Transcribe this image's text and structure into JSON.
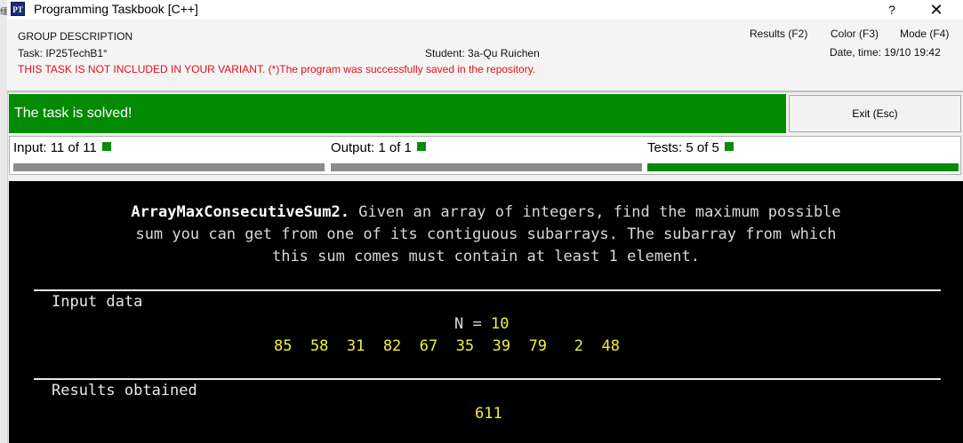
{
  "window": {
    "edge_glyph": "缅",
    "icon_text": "PT",
    "title": "Programming Taskbook [C++]",
    "help_label": "?",
    "close_label": "✕"
  },
  "header": {
    "group": "GROUP DESCRIPTION",
    "task": "Task: IP25TechB1°",
    "student": "Student: 3a-Qu Ruichen",
    "warning": "THIS TASK IS NOT INCLUDED IN YOUR VARIANT. (*)The program was successfully saved in the repository.",
    "menu": {
      "results": "Results (F2)",
      "color": "Color (F3)",
      "mode": "Mode (F4)"
    },
    "datetime": "Date, time: 19/10 19:42"
  },
  "status": {
    "message": "The task is solved!",
    "exit_label": "Exit (Esc)",
    "color": "#038a03"
  },
  "stats": {
    "input": {
      "label": "Input: 11 of 11",
      "progress": 1.0,
      "bar_color": "#8c8c8c"
    },
    "output": {
      "label": "Output: 1 of 1",
      "progress": 1.0,
      "bar_color": "#8c8c8c"
    },
    "tests": {
      "label": "Tests: 5 of 5",
      "progress": 1.0,
      "bar_color": "#0a8a0a"
    }
  },
  "task": {
    "name": "ArrayMaxConsecutiveSum2.",
    "line1_rest": " Given an array of integers, find the maximum possible",
    "line2": "sum you can get from one of its contiguous subarrays. The subarray from which",
    "line3": "this sum comes must contain at least 1 element."
  },
  "input_data": {
    "title": "Input data",
    "n_label": "N = ",
    "n_value": "10",
    "values_line": "85  58  31  82  67  35  39  79   2  48"
  },
  "results": {
    "title": "Results obtained",
    "value": "611"
  }
}
